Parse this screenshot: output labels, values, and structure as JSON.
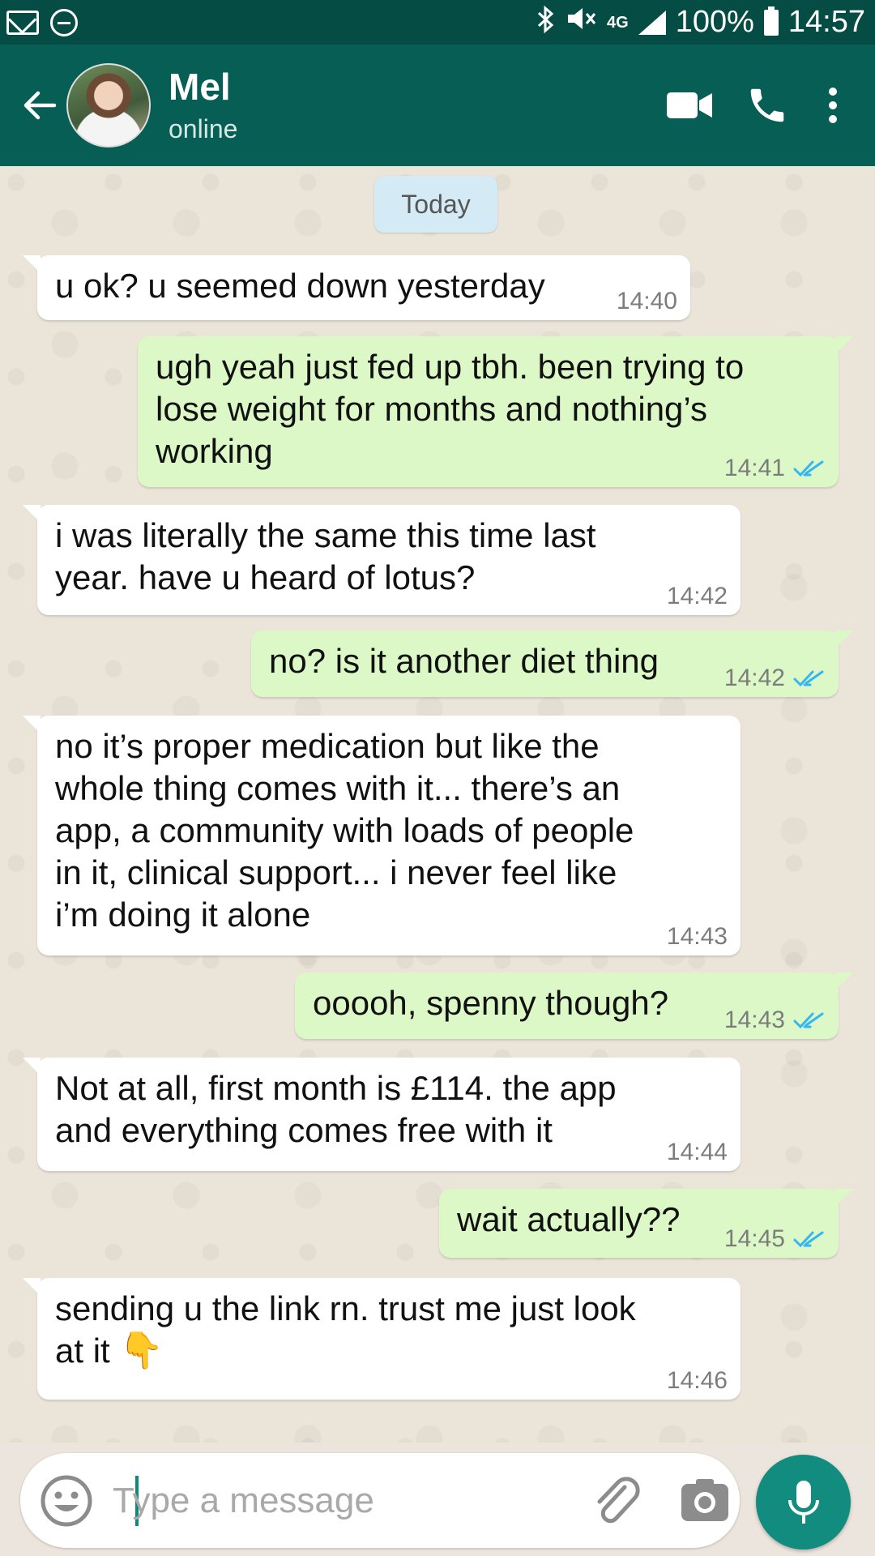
{
  "status_bar": {
    "network": "4G",
    "battery": "100%",
    "time": "14:57",
    "icons": [
      "mail-icon",
      "do-not-disturb-icon",
      "bluetooth-icon",
      "mute-icon",
      "signal-icon",
      "battery-icon"
    ]
  },
  "header": {
    "contact_name": "Mel",
    "contact_status": "online",
    "icons": [
      "back-arrow-icon",
      "video-call-icon",
      "phone-icon",
      "more-vert-icon"
    ]
  },
  "chat": {
    "date_label": "Today",
    "messages": [
      {
        "dir": "in",
        "text": "u ok? u seemed down yesterday",
        "time": "14:40"
      },
      {
        "dir": "out",
        "text": "ugh yeah just fed up tbh. been trying to\nlose weight for months and nothing’s\nworking",
        "time": "14:41",
        "status": "read"
      },
      {
        "dir": "in",
        "text": "i was literally the same this time last\nyear. have u heard of lotus?",
        "time": "14:42"
      },
      {
        "dir": "out",
        "text": "no? is it another diet thing",
        "time": "14:42",
        "status": "read"
      },
      {
        "dir": "in",
        "text": "no it’s proper medication but like the\nwhole thing comes with it... there’s an\napp, a community with loads of people\nin it, clinical support... i never feel like\ni’m doing it alone",
        "time": "14:43"
      },
      {
        "dir": "out",
        "text": "ooooh, spenny though?",
        "time": "14:43",
        "status": "read"
      },
      {
        "dir": "in",
        "text": "Not at all, first month is £114. the app\nand everything comes free with it",
        "time": "14:44"
      },
      {
        "dir": "out",
        "text": "wait actually??",
        "time": "14:45",
        "status": "read"
      },
      {
        "dir": "in",
        "text": "sending u the link rn. trust me just look\nat it",
        "emoji": "👇",
        "time": "14:46"
      }
    ]
  },
  "composer": {
    "placeholder": "Type a message",
    "value": "",
    "icons": [
      "emoji-icon",
      "attach-icon",
      "camera-icon",
      "mic-icon"
    ]
  },
  "colors": {
    "status_bar": "#054d44",
    "header": "#075e54",
    "incoming_bubble": "#ffffff",
    "outgoing_bubble": "#dcf8c6",
    "read_tick": "#34b7f1",
    "mic_button": "#128c7e"
  }
}
